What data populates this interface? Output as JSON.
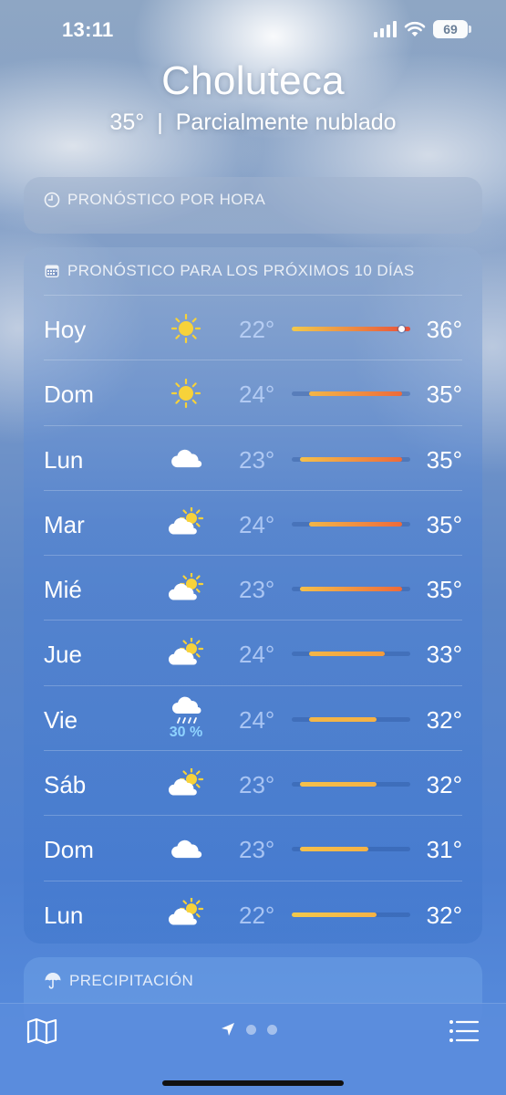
{
  "status_bar": {
    "time": "13:11",
    "battery": "69"
  },
  "header": {
    "city": "Choluteca",
    "temp": "35°",
    "separator": "|",
    "condition": "Parcialmente nublado"
  },
  "hourly": {
    "title": "PRONÓSTICO POR HORA",
    "icon": "clock-icon"
  },
  "daily": {
    "title": "PRONÓSTICO PARA LOS PRÓXIMOS 10 DÍAS",
    "icon": "calendar-icon",
    "range_min": 22,
    "range_max": 36,
    "days": [
      {
        "day": "Hoy",
        "icon": "sun",
        "precip": "",
        "low": "22°",
        "high": "36°",
        "low_val": 22,
        "high_val": 36,
        "current": 35
      },
      {
        "day": "Dom",
        "icon": "sun",
        "precip": "",
        "low": "24°",
        "high": "35°",
        "low_val": 24,
        "high_val": 35
      },
      {
        "day": "Lun",
        "icon": "cloud",
        "precip": "",
        "low": "23°",
        "high": "35°",
        "low_val": 23,
        "high_val": 35
      },
      {
        "day": "Mar",
        "icon": "partly-cloudy",
        "precip": "",
        "low": "24°",
        "high": "35°",
        "low_val": 24,
        "high_val": 35
      },
      {
        "day": "Mié",
        "icon": "partly-cloudy",
        "precip": "",
        "low": "23°",
        "high": "35°",
        "low_val": 23,
        "high_val": 35
      },
      {
        "day": "Jue",
        "icon": "partly-cloudy",
        "precip": "",
        "low": "24°",
        "high": "33°",
        "low_val": 24,
        "high_val": 33
      },
      {
        "day": "Vie",
        "icon": "rain",
        "precip": "30 %",
        "low": "24°",
        "high": "32°",
        "low_val": 24,
        "high_val": 32
      },
      {
        "day": "Sáb",
        "icon": "partly-cloudy",
        "precip": "",
        "low": "23°",
        "high": "32°",
        "low_val": 23,
        "high_val": 32
      },
      {
        "day": "Dom",
        "icon": "cloud",
        "precip": "",
        "low": "23°",
        "high": "31°",
        "low_val": 23,
        "high_val": 31
      },
      {
        "day": "Lun",
        "icon": "partly-cloudy",
        "precip": "",
        "low": "22°",
        "high": "32°",
        "low_val": 22,
        "high_val": 32
      }
    ]
  },
  "precipitation": {
    "title": "PRECIPITACIÓN",
    "icon": "umbrella-icon"
  },
  "bottom_bar": {
    "map_icon": "map-icon",
    "location_icon": "location-arrow-icon",
    "list_icon": "list-icon"
  }
}
